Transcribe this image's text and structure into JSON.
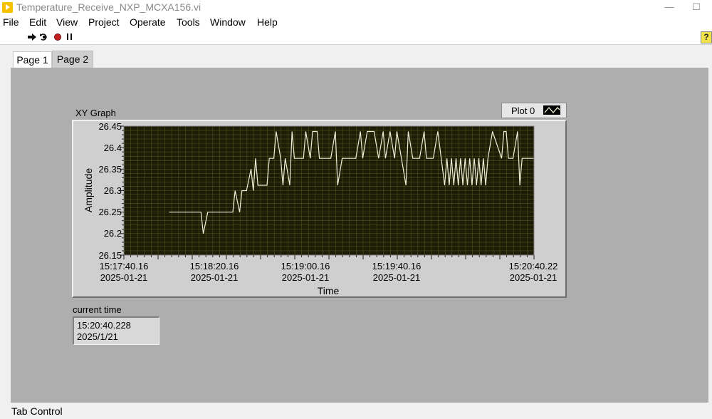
{
  "window": {
    "title": "Temperature_Receive_NXP_MCXA156.vi",
    "controls": {
      "minimize": "—",
      "maximize": "☐"
    }
  },
  "menu": [
    "File",
    "Edit",
    "View",
    "Project",
    "Operate",
    "Tools",
    "Window",
    "Help"
  ],
  "toolbar": {
    "run_icon": "run-arrow-icon",
    "run_continuous_icon": "run-continuously-icon",
    "abort_icon": "abort-execution-icon",
    "pause_icon": "pause-icon",
    "help_label": "?"
  },
  "tabs": [
    {
      "label": "Page 1",
      "selected": false
    },
    {
      "label": "Page 2",
      "selected": true
    }
  ],
  "graph": {
    "label": "XY Graph",
    "legend": "Plot 0",
    "plot_area_color": "#1c1c07",
    "grid_color": "#5f6622",
    "trace_color": "#f0f0d8"
  },
  "chart_data": {
    "type": "line",
    "title": "XY Graph",
    "xlabel": "Time",
    "ylabel": "Amplitude",
    "ylim": [
      26.15,
      26.45
    ],
    "x_tick_labels": [
      {
        "time": "15:17:40.16",
        "date": "2025-01-21"
      },
      {
        "time": "15:18:20.16",
        "date": "2025-01-21"
      },
      {
        "time": "15:19:00.16",
        "date": "2025-01-21"
      },
      {
        "time": "15:19:40.16",
        "date": "2025-01-21"
      },
      {
        "time": "15:20:40.22",
        "date": "2025-01-21"
      }
    ],
    "y_tick_labels": [
      "26.45",
      "26.4",
      "26.35",
      "26.3",
      "26.25",
      "26.2",
      "26.15"
    ],
    "series": [
      {
        "name": "Plot 0",
        "x": [
          "15:18:00",
          "15:18:12",
          "15:18:14",
          "15:18:15",
          "15:18:17",
          "15:18:26",
          "15:18:28",
          "15:18:29",
          "15:18:31",
          "15:18:32",
          "15:18:34",
          "15:18:36",
          "15:18:37",
          "15:18:38",
          "15:18:39",
          "15:18:43",
          "15:18:44",
          "15:18:46",
          "15:18:47",
          "15:18:49",
          "15:18:50",
          "15:18:51",
          "15:18:53",
          "15:18:54",
          "15:18:55",
          "15:18:56",
          "15:18:59",
          "15:19:00",
          "15:19:02",
          "15:19:03",
          "15:19:05",
          "15:19:06",
          "15:19:11",
          "15:19:13",
          "15:19:14",
          "15:19:16",
          "15:19:22",
          "15:19:24",
          "15:19:25",
          "15:19:27",
          "15:19:30",
          "15:19:32",
          "15:19:34",
          "15:19:35",
          "15:19:37",
          "15:19:39",
          "15:19:40",
          "15:19:42",
          "15:19:44",
          "15:19:45",
          "15:19:47",
          "15:19:50",
          "15:19:52",
          "15:19:53",
          "15:19:55",
          "15:19:56",
          "15:19:58",
          "15:20:01",
          "15:20:02",
          "15:20:03",
          "15:20:04",
          "15:20:05",
          "15:20:06",
          "15:20:07",
          "15:20:08",
          "15:20:09",
          "15:20:10",
          "15:20:11",
          "15:20:12",
          "15:20:13",
          "15:20:14",
          "15:20:15",
          "15:20:16",
          "15:20:17",
          "15:20:18",
          "15:20:19",
          "15:20:20",
          "15:20:22",
          "15:20:26",
          "15:20:27",
          "15:20:28",
          "15:20:29",
          "15:20:31",
          "15:20:33",
          "15:20:34",
          "15:20:35",
          "15:20:37",
          "15:20:40"
        ],
        "y": [
          26.25,
          26.25,
          26.25,
          26.2,
          26.25,
          26.25,
          26.25,
          26.3,
          26.25,
          26.3,
          26.3,
          26.35,
          26.3,
          26.375,
          26.3125,
          26.3125,
          26.375,
          26.375,
          26.4375,
          26.375,
          26.3125,
          26.375,
          26.3125,
          26.4375,
          26.375,
          26.375,
          26.375,
          26.4375,
          26.375,
          26.4375,
          26.4375,
          26.375,
          26.375,
          26.4375,
          26.3125,
          26.375,
          26.375,
          26.4375,
          26.375,
          26.4375,
          26.4375,
          26.375,
          26.4375,
          26.375,
          26.4375,
          26.375,
          26.4375,
          26.375,
          26.3125,
          26.4375,
          26.375,
          26.375,
          26.4375,
          26.375,
          26.375,
          26.375,
          26.4375,
          26.3125,
          26.375,
          26.3125,
          26.375,
          26.3125,
          26.375,
          26.3125,
          26.375,
          26.3125,
          26.375,
          26.3125,
          26.375,
          26.3125,
          26.375,
          26.3125,
          26.375,
          26.3125,
          26.375,
          26.3125,
          26.375,
          26.4375,
          26.375,
          26.4375,
          26.4375,
          26.375,
          26.375,
          26.4375,
          26.3125,
          26.375,
          26.375,
          26.375
        ]
      }
    ]
  },
  "current_time": {
    "label": "current time",
    "time": "15:20:40.228",
    "date": "2025/1/21"
  },
  "tab_control_label": "Tab Control"
}
